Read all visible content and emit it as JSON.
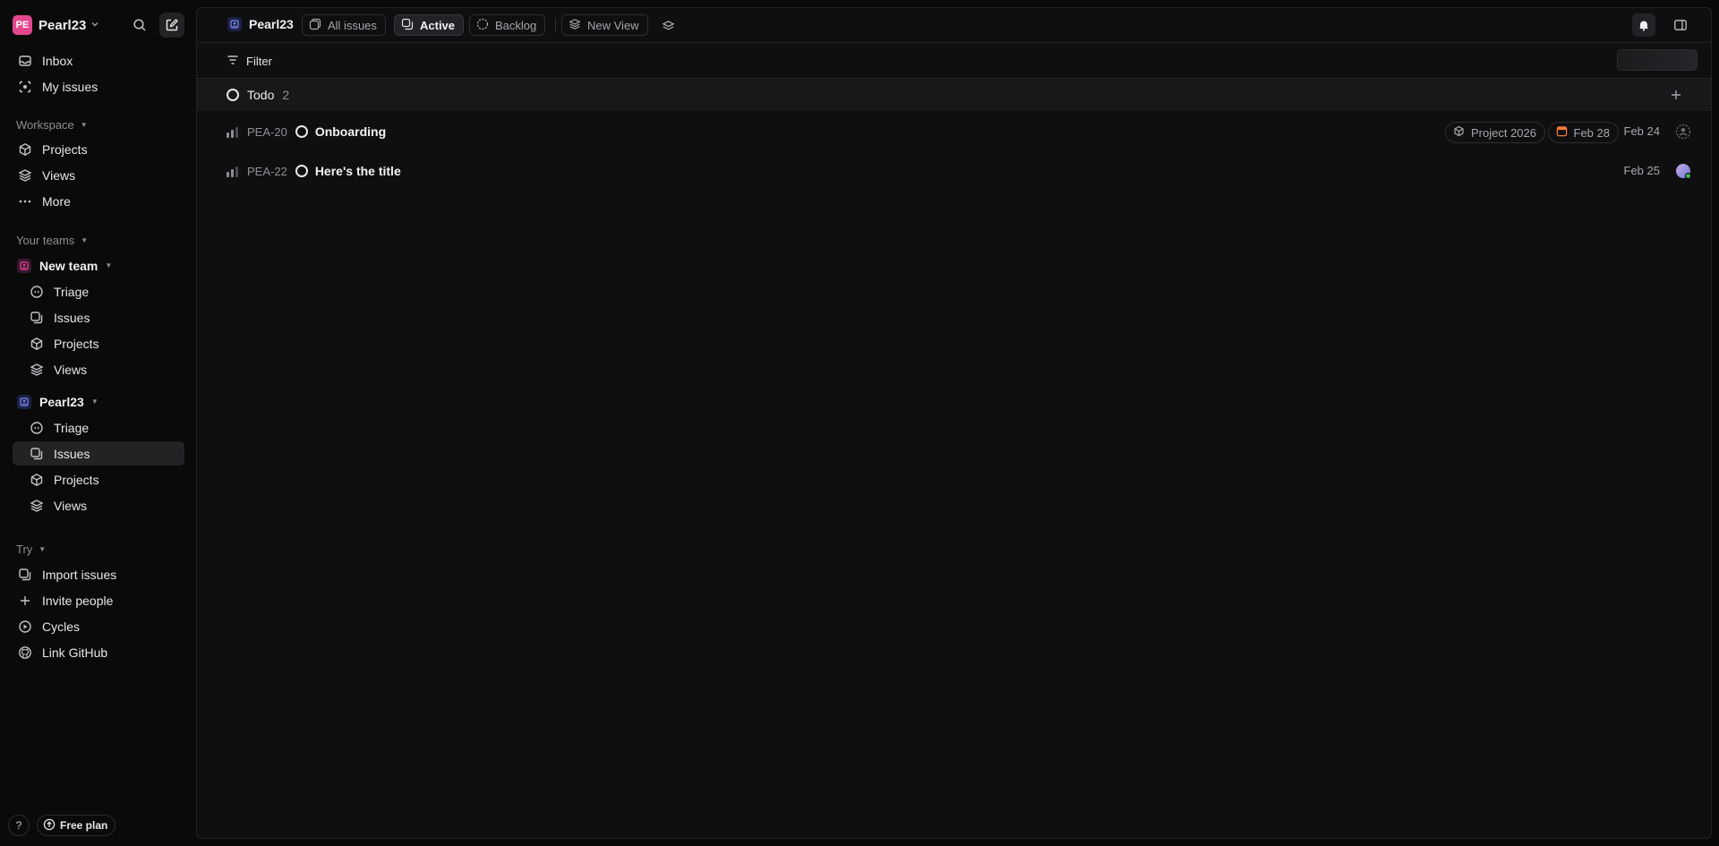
{
  "workspace": {
    "initials": "PE",
    "name": "Pearl23"
  },
  "nav": {
    "inbox": "Inbox",
    "my_issues": "My issues"
  },
  "workspace_section": {
    "label": "Workspace",
    "items": [
      {
        "label": "Projects"
      },
      {
        "label": "Views"
      },
      {
        "label": "More"
      }
    ]
  },
  "teams_section": {
    "label": "Your teams",
    "teams": [
      {
        "name": "New team",
        "items": [
          {
            "label": "Triage"
          },
          {
            "label": "Issues"
          },
          {
            "label": "Projects"
          },
          {
            "label": "Views"
          }
        ]
      },
      {
        "name": "Pearl23",
        "items": [
          {
            "label": "Triage"
          },
          {
            "label": "Issues"
          },
          {
            "label": "Projects"
          },
          {
            "label": "Views"
          }
        ]
      }
    ]
  },
  "try_section": {
    "label": "Try",
    "items": [
      {
        "label": "Import issues"
      },
      {
        "label": "Invite people"
      },
      {
        "label": "Cycles"
      },
      {
        "label": "Link GitHub"
      }
    ]
  },
  "footer": {
    "help": "?",
    "plan": "Free plan"
  },
  "header": {
    "team": "Pearl23",
    "tabs": [
      {
        "label": "All issues",
        "active": false
      },
      {
        "label": "Active",
        "active": true
      },
      {
        "label": "Backlog",
        "active": false
      },
      {
        "label": "New View",
        "active": false
      }
    ]
  },
  "filter": {
    "label": "Filter"
  },
  "group": {
    "name": "Todo",
    "count": "2"
  },
  "issues": [
    {
      "id": "PEA-20",
      "title": "Onboarding",
      "project": "Project 2026",
      "due": "Feb 28",
      "created": "Feb 24"
    },
    {
      "id": "PEA-22",
      "title": "Here's the title",
      "created": "Feb 25"
    }
  ],
  "colors": {
    "workspace_avatar": "#e3478d",
    "new_team_badge": "#e3478d",
    "pearl23_badge": "#5b6ee1",
    "due_date_icon": "#f07a3a",
    "assignee_online": "#3fb950"
  }
}
